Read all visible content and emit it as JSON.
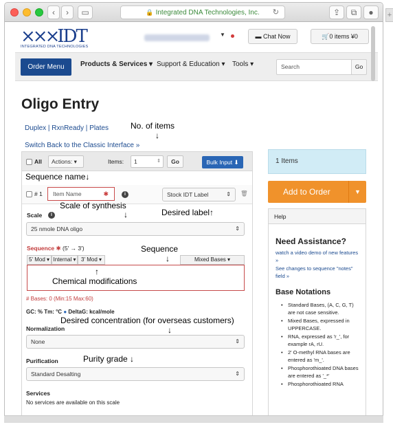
{
  "browser": {
    "address": "Integrated DNA Technologies, Inc.",
    "new_tab": "+"
  },
  "header": {
    "logo_mark": "IDT",
    "logo_sub": "INTEGRATED DNA TECHNOLOGIES",
    "chat": "Chat Now",
    "cart": "0 items ¥0"
  },
  "nav": {
    "order_menu": "Order Menu",
    "items": [
      "Products & Services ▾",
      "Support & Education ▾",
      "Tools ▾"
    ],
    "search_placeholder": "Search",
    "go": "Go"
  },
  "page": {
    "title": "Oligo Entry",
    "links": [
      "Duplex",
      "RxnReady",
      "Plates"
    ],
    "switch": "Switch Back to the Classic Interface »"
  },
  "toolbar": {
    "all": "All",
    "actions": "Actions: ▾",
    "items_label": "Items:",
    "items_value": "1",
    "go": "Go",
    "bulk": "Bulk Input ⬇"
  },
  "item": {
    "num": "# 1",
    "name_placeholder": "Item Name",
    "label_select": "Stock IDT Label"
  },
  "scale": {
    "label": "Scale",
    "value": "25 nmole DNA oligo"
  },
  "sequence": {
    "label": "Sequence",
    "direction": "(5' → 3')",
    "mods": [
      "5' Mod ▾",
      "Internal ▾",
      "3' Mod ▾"
    ],
    "mixed": "Mixed Bases ▾"
  },
  "stats": {
    "bases": "# Bases: 0 (Min:15 Max:60)",
    "gc": "GC: %  Tm: °C",
    "deltag": "DeltaG: kcal/mole"
  },
  "normalization": {
    "label": "Normalization",
    "value": "None"
  },
  "purification": {
    "label": "Purification",
    "value": "Standard Desalting"
  },
  "services": {
    "label": "Services",
    "text": "No services are available on this scale"
  },
  "sidebar": {
    "items_count": "1 Items",
    "add_to_order": "Add to Order",
    "help_head": "Help",
    "help_title": "Need Assistance?",
    "link1": "watch a video demo of new features »",
    "link2": "See changes to sequence \"notes\" field »",
    "bn_title": "Base Notations",
    "bn_items": [
      "Standard Bases, (A, C, G, T) are not case sensitive.",
      "Mixed Bases, expressed in UPPERCASE.",
      "RNA, expressed as 'r_', for example rA, rU.",
      "2' O-methyl RNA bases are entered as 'm_'.",
      "Phosphorothioated DNA bases are entered as '_*'",
      "Phosphorothioated RNA"
    ]
  },
  "annotations": {
    "no_items": "No. of items",
    "sequence_name": "Sequence name",
    "scale": "Scale of synthesis",
    "label": "Desired label",
    "sequence": "Sequence",
    "chem": "Chemical modifications",
    "conc": "Desired concentration (for overseas customers)",
    "purity": "Purity grade",
    "arrow_down": "↓",
    "arrow_up": "↑"
  },
  "colors": {
    "brand_blue": "#1b4a8f",
    "add_orange": "#f0922b",
    "items_blue": "#d1ecf6",
    "required_red": "#c93a3a"
  }
}
